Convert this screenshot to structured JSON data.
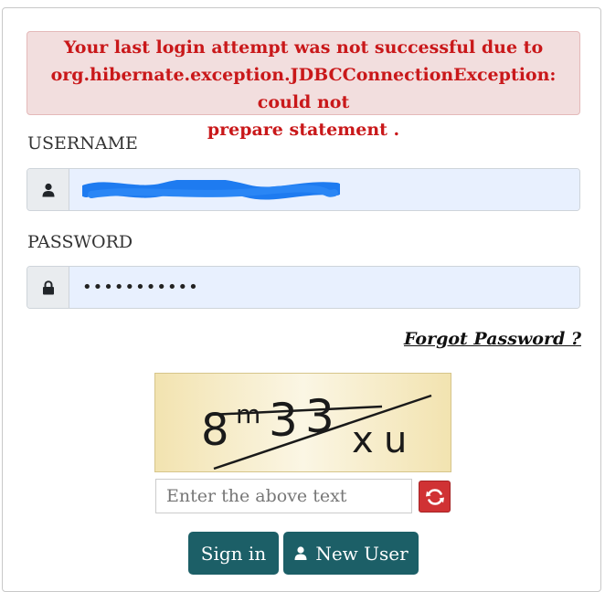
{
  "alert": {
    "lines": [
      "Your last login attempt was not successful due to",
      "org.hibernate.exception.JDBCConnectionException: could not",
      "prepare statement ."
    ]
  },
  "username": {
    "label": "USERNAME",
    "icon": "user-icon"
  },
  "password": {
    "label": "PASSWORD",
    "icon": "lock-icon",
    "masked_value": "•••••••••••"
  },
  "forgot_password": "Forgot Password ?",
  "captcha": {
    "placeholder": "Enter the above text",
    "refresh_icon": "refresh-icon"
  },
  "buttons": {
    "sign_in": "Sign in",
    "new_user": "New User",
    "new_user_icon": "user-icon"
  },
  "colors": {
    "alert_text": "#c9181a",
    "alert_bg": "#f2dede",
    "button_bg": "#1c5f67",
    "refresh_bg": "#d03234",
    "input_autofill_bg": "#e8f0fe"
  }
}
